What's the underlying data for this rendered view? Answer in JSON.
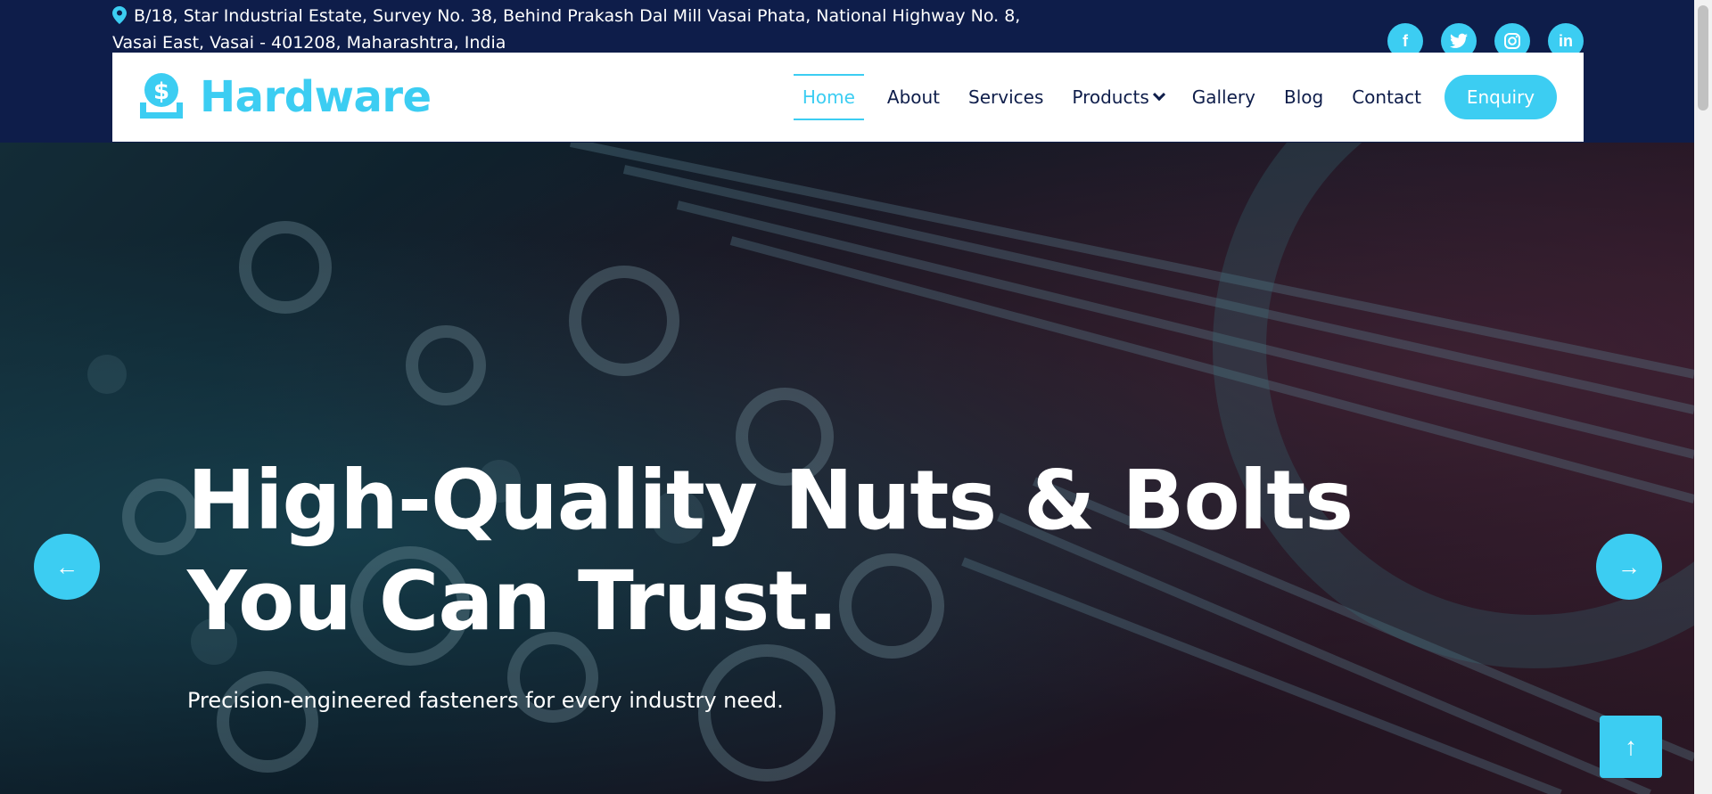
{
  "topbar": {
    "address": "B/18, Star Industrial Estate, Survey No. 38, Behind Prakash Dal Mill Vasai Phata, National Highway No. 8, Vasai East, Vasai - 401208, Maharashtra, India",
    "socials": [
      {
        "name": "facebook",
        "glyph": "f"
      },
      {
        "name": "twitter",
        "glyph": "t"
      },
      {
        "name": "instagram",
        "glyph": "◎"
      },
      {
        "name": "linkedin",
        "glyph": "in"
      }
    ]
  },
  "navbar": {
    "brand": "Hardware",
    "menu": [
      "Home",
      "About",
      "Services",
      "Products",
      "Gallery",
      "Blog",
      "Contact"
    ],
    "active": "Home",
    "enquiry_label": "Enquiry"
  },
  "hero": {
    "title": "High-Quality Nuts & Bolts You Can Trust.",
    "subtitle": "Precision-engineered fasteners for every industry need.",
    "prev_glyph": "←",
    "next_glyph": "→"
  },
  "to_top_glyph": "↑",
  "colors": {
    "accent": "#3ccdf2",
    "navy": "#0e1d4a",
    "white": "#ffffff"
  }
}
